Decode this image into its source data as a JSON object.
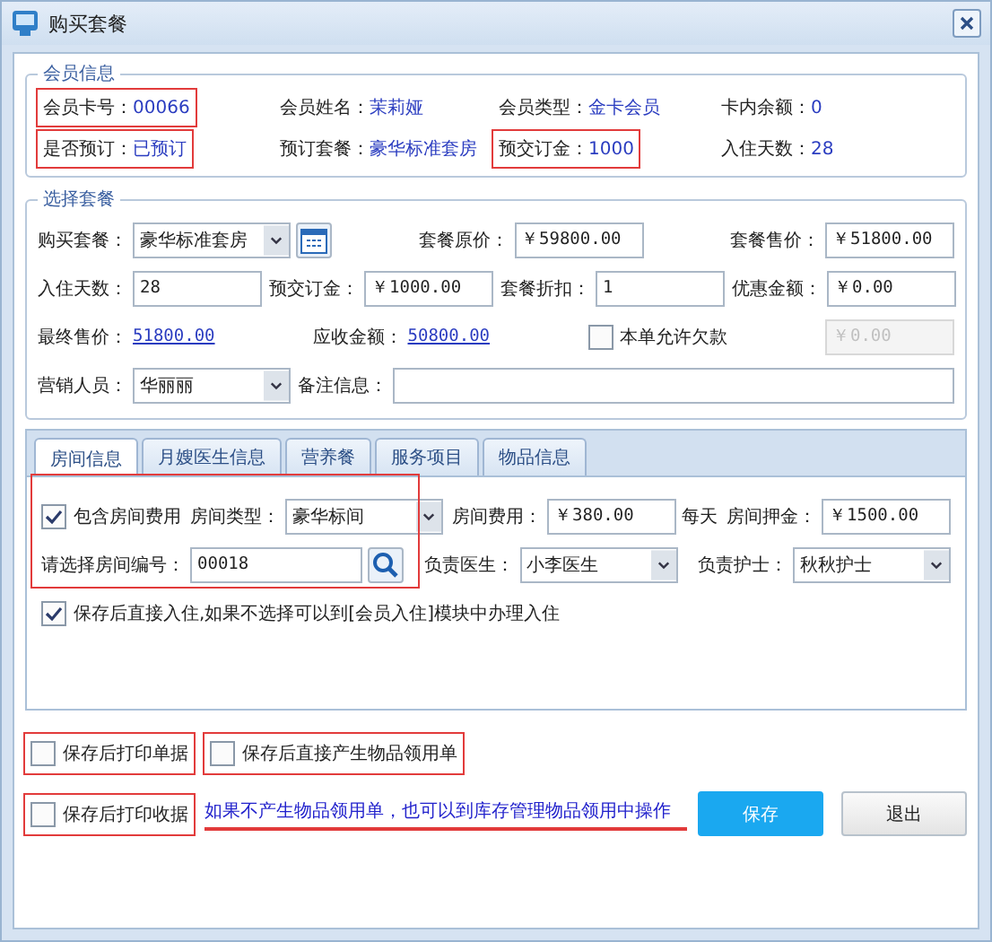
{
  "window": {
    "title": "购买套餐"
  },
  "member": {
    "legend": "会员信息",
    "fields": [
      {
        "label": "会员卡号：",
        "value": "00066",
        "highlighted": true
      },
      {
        "label": "会员姓名：",
        "value": "茉莉娅",
        "highlighted": false
      },
      {
        "label": "会员类型：",
        "value": "金卡会员",
        "highlighted": false
      },
      {
        "label": "卡内余额：",
        "value": "0",
        "highlighted": false
      },
      {
        "label": "是否预订：",
        "value": "已预订",
        "highlighted": true
      },
      {
        "label": "预订套餐：",
        "value": "豪华标准套房",
        "highlighted": false
      },
      {
        "label": "预交订金：",
        "value": "1000",
        "highlighted": true
      },
      {
        "label": "入住天数：",
        "value": "28",
        "highlighted": false
      }
    ]
  },
  "package": {
    "legend": "选择套餐",
    "lines": [
      {
        "fields": [
          {
            "kind": "select",
            "label": "购买套餐：",
            "value": "豪华标准套房",
            "calendar": true
          },
          {
            "kind": "input",
            "label": "套餐原价：",
            "value": "￥59800.00"
          },
          {
            "kind": "input",
            "label": "套餐售价：",
            "value": "￥51800.00"
          }
        ]
      },
      {
        "fields": [
          {
            "kind": "input",
            "label": "入住天数：",
            "value": "28"
          },
          {
            "kind": "input",
            "label": "预交订金：",
            "value": "￥1000.00"
          },
          {
            "kind": "input",
            "label": "套餐折扣：",
            "value": "1"
          },
          {
            "kind": "input",
            "label": "优惠金额：",
            "value": "￥0.00"
          }
        ]
      },
      {
        "fields": [
          {
            "kind": "link",
            "label": "最终售价：",
            "value": "51800.00"
          },
          {
            "kind": "link",
            "label": "应收金额：",
            "value": "50800.00"
          },
          {
            "kind": "checkbox",
            "label": "本单允许欠款",
            "checked": false
          },
          {
            "kind": "input",
            "value": "￥0.00",
            "disabled": true
          }
        ]
      },
      {
        "fields": [
          {
            "kind": "select",
            "label": "营销人员：",
            "value": "华丽丽"
          },
          {
            "kind": "input",
            "label": "备注信息：",
            "wide": true
          }
        ]
      }
    ]
  },
  "tabs": [
    {
      "label": "房间信息",
      "selected": true
    },
    {
      "label": "月嫂医生信息",
      "selected": false
    },
    {
      "label": "营养餐",
      "selected": false
    },
    {
      "label": "服务项目",
      "selected": false
    },
    {
      "label": "物品信息",
      "selected": false
    }
  ],
  "room": {
    "highlighted": true,
    "lines": [
      {
        "fields": [
          {
            "kind": "checkbox",
            "label": "包含房间费用",
            "checked": true
          },
          {
            "kind": "select",
            "label": "房间类型：",
            "value": "豪华标间"
          },
          {
            "kind": "input",
            "label": "房间费用：",
            "value": "￥380.00",
            "unit": "每天"
          },
          {
            "kind": "input",
            "label": "房间押金：",
            "value": "￥1500.00"
          }
        ]
      },
      {
        "fields": [
          {
            "kind": "search",
            "label": "请选择房间编号：",
            "value": "00018"
          },
          {
            "kind": "select",
            "label": "负责医生：",
            "value": "小李医生"
          },
          {
            "kind": "select",
            "label": "负责护士：",
            "value": "秋秋护士"
          }
        ]
      },
      {
        "fields": [
          {
            "kind": "checkbox",
            "label": "保存后直接入住,如果不选择可以到[会员入住]模块中办理入住",
            "checked": true
          }
        ]
      }
    ]
  },
  "options": [
    {
      "label": "保存后打印单据",
      "checked": false,
      "highlighted": true
    },
    {
      "label": "保存后直接产生物品领用单",
      "checked": false,
      "highlighted": true
    },
    {
      "label": "保存后打印收据",
      "checked": false,
      "highlighted": true
    }
  ],
  "note": {
    "text": "如果不产生物品领用单，也可以到库存管理物品领用中操作",
    "underlined": true
  },
  "buttons": [
    {
      "label": "保存",
      "kind": "primary"
    },
    {
      "label": "退出",
      "kind": "default"
    }
  ]
}
